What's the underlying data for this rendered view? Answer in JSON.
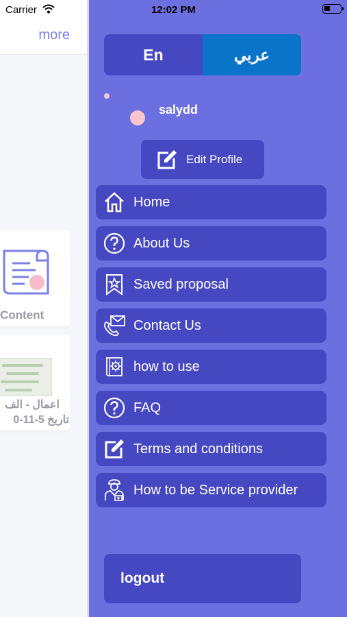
{
  "status_bar": {
    "carrier": "Carrier",
    "time": "12:02 PM"
  },
  "left_page": {
    "more_label": "more",
    "card1_label": "Content",
    "card2_line1": "اعمال - الف",
    "card2_line2": "تاريخ 5-11-0"
  },
  "drawer": {
    "lang_en": "En",
    "lang_ar": "عربي",
    "username": "salydd",
    "edit_profile": "Edit Profile",
    "items": [
      {
        "label": "Home",
        "icon": "home-icon"
      },
      {
        "label": "About Us",
        "icon": "question-icon"
      },
      {
        "label": "Saved proposal",
        "icon": "bookmark-star-icon"
      },
      {
        "label": "Contact Us",
        "icon": "phone-mail-icon"
      },
      {
        "label": "how to use",
        "icon": "book-gear-icon"
      },
      {
        "label": "FAQ",
        "icon": "question-icon"
      },
      {
        "label": "Terms and conditions",
        "icon": "edit-icon"
      },
      {
        "label": "How to be Service provider",
        "icon": "provider-icon"
      }
    ],
    "logout": "logout"
  },
  "colors": {
    "drawer_bg": "#6b6fe0",
    "item_bg": "#4548c0",
    "arabic_active": "#0a74c9",
    "accent_pink": "#f9c5cf"
  }
}
